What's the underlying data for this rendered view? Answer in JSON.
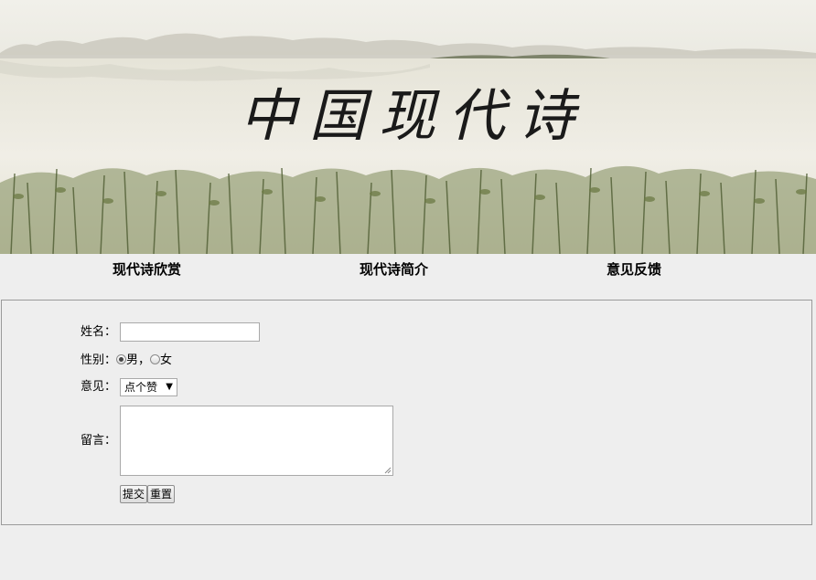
{
  "banner": {
    "title": "中国现代诗"
  },
  "nav": {
    "items": [
      {
        "label": "现代诗欣赏"
      },
      {
        "label": "现代诗简介"
      },
      {
        "label": "意见反馈"
      }
    ]
  },
  "form": {
    "name_label": "姓名：",
    "name_value": "",
    "gender_label": "性别：",
    "gender_options": [
      {
        "label": "男",
        "checked": true
      },
      {
        "label": "女",
        "checked": false
      }
    ],
    "gender_separator": "，",
    "opinion_label": "意见：",
    "opinion_selected": "点个赞",
    "message_label": "留言：",
    "submit_label": "提交",
    "reset_label": "重置"
  },
  "colors": {
    "page_bg": "#eeeeee",
    "border": "#9a9a9a"
  }
}
